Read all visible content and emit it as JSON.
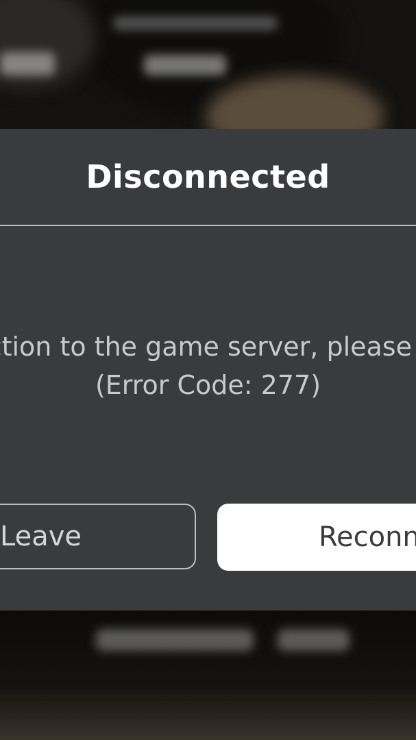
{
  "dialog": {
    "title": "Disconnected",
    "message_line1": "ection to the game server, please",
    "message_line2": "(Error Code: 277)",
    "leave_label": "Leave",
    "reconnect_label": "Reconn"
  },
  "colors": {
    "dialog_bg": "#393b3d",
    "title_text": "#ffffff",
    "message_text": "#c9cacc",
    "primary_button_bg": "#ffffff",
    "secondary_button_border": "#bdbec0"
  }
}
